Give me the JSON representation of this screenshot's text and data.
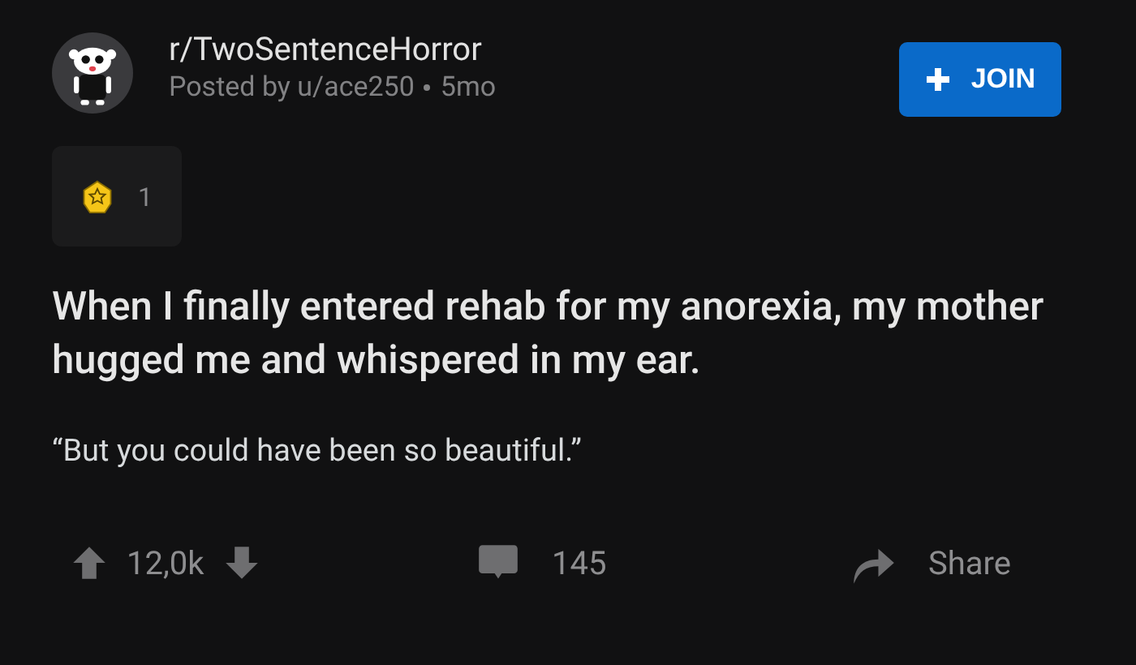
{
  "post": {
    "subreddit": "r/TwoSentenceHorror",
    "byline": "Posted by u/ace250",
    "age": "5mo",
    "join_button": "JOIN",
    "award_count": "1",
    "title": "When I finally entered rehab for my anorexia, my mother hugged me and whispered in my ear.",
    "body": "“But you could have been so beautiful.”"
  },
  "actions": {
    "score": "12,0k",
    "comments": "145",
    "share": "Share"
  }
}
